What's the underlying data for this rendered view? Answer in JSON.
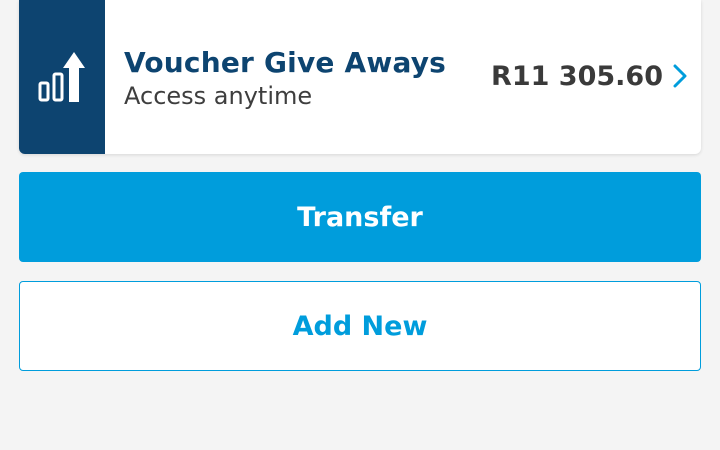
{
  "account": {
    "title": "Voucher Give Aways",
    "subtitle": "Access anytime",
    "balance": "R11 305.60",
    "icon": "growth-chart-icon",
    "chevron_icon": "chevron-right-icon"
  },
  "actions": {
    "transfer_label": "Transfer",
    "add_new_label": "Add New"
  },
  "colors": {
    "icon_tile": "#0d4470",
    "title": "#0d4470",
    "primary": "#009ddc",
    "background": "#f4f4f4"
  }
}
